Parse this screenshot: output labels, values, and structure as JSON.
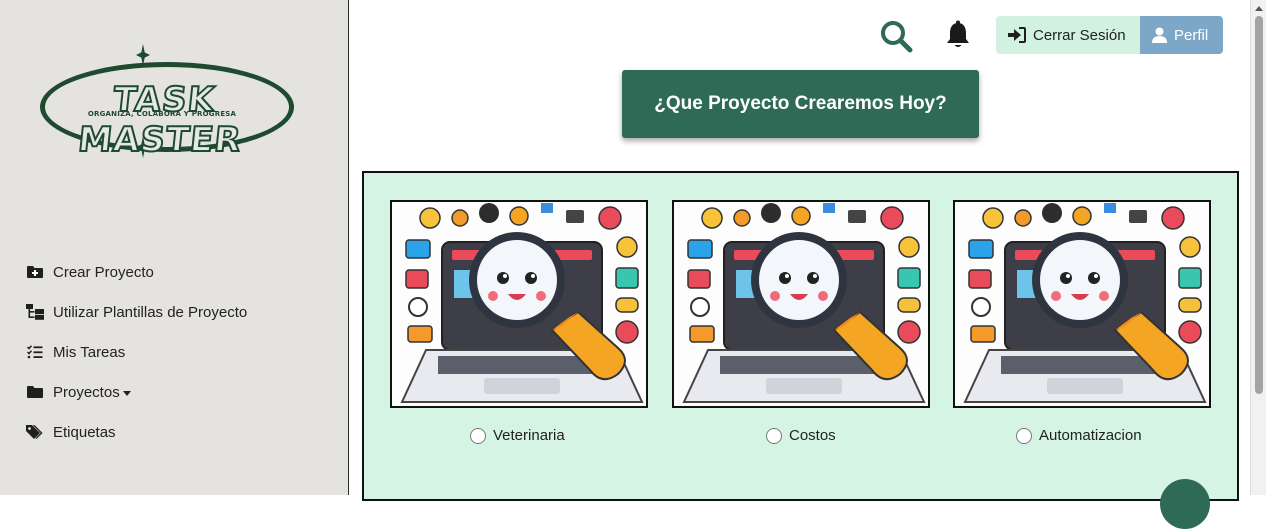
{
  "sidebar": {
    "logo": {
      "title": "TASK MASTER",
      "subtitle": "ORGANIZA, COLABORA Y PROGRESA"
    },
    "items": [
      {
        "label": "Crear Proyecto",
        "icon": "folder-plus-icon"
      },
      {
        "label": "Utilizar Plantillas de Proyecto",
        "icon": "folder-tree-icon"
      },
      {
        "label": "Mis Tareas",
        "icon": "list-check-icon"
      },
      {
        "label": "Proyectos",
        "icon": "folder-icon"
      },
      {
        "label": "Etiquetas",
        "icon": "tags-icon"
      }
    ]
  },
  "header": {
    "logout_label": "Cerrar Sesión",
    "profile_label": "Perfil"
  },
  "main": {
    "headline": "¿Que Proyecto Crearemos Hoy?",
    "templates": [
      {
        "label": "Veterinaria",
        "selected": false
      },
      {
        "label": "Costos",
        "selected": false
      },
      {
        "label": "Automatizacion",
        "selected": false
      }
    ]
  },
  "colors": {
    "accent": "#2e6a56",
    "panel_bg": "#d6f4e4",
    "sidebar_bg": "#e5e3df",
    "logout_bg": "#d3f1e1",
    "profile_bg": "#7ca7c7",
    "logo": "#1d4a30"
  }
}
